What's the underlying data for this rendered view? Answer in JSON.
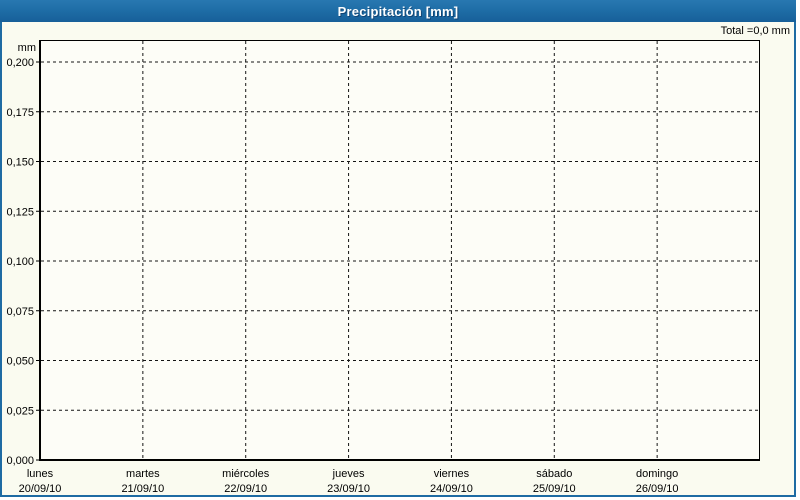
{
  "header": {
    "title": "Precipitación [mm]"
  },
  "total_label": "Total =0,0 mm",
  "chart_data": {
    "type": "line",
    "title": "Precipitación [mm]",
    "xlabel": "",
    "ylabel": "mm",
    "ylim": [
      0,
      0.211
    ],
    "ytick_step": 0.025,
    "ytick_labels": [
      "0,000",
      "0,025",
      "0,050",
      "0,075",
      "0,100",
      "0,125",
      "0,150",
      "0,175",
      "0,200"
    ],
    "categories": [
      {
        "day": "lunes",
        "date": "20/09/10"
      },
      {
        "day": "martes",
        "date": "21/09/10"
      },
      {
        "day": "miércoles",
        "date": "22/09/10"
      },
      {
        "day": "jueves",
        "date": "23/09/10"
      },
      {
        "day": "viernes",
        "date": "24/09/10"
      },
      {
        "day": "sábado",
        "date": "25/09/10"
      },
      {
        "day": "domingo",
        "date": "26/09/10"
      }
    ],
    "series": [
      {
        "name": "Precipitación",
        "values": [
          0,
          0,
          0,
          0,
          0,
          0,
          0
        ]
      }
    ],
    "total_label": "Total =0,0 mm",
    "grid": true,
    "legend_position": "none"
  },
  "colors": {
    "header_blue": "#1e6ba3",
    "border_blue": "#1e6ba3",
    "page_bg": "#fafbf0",
    "plot_bg": "#fdfdf7",
    "grid": "#151515",
    "axis": "#000000",
    "text": "#000000",
    "title_text": "#ffffff"
  }
}
